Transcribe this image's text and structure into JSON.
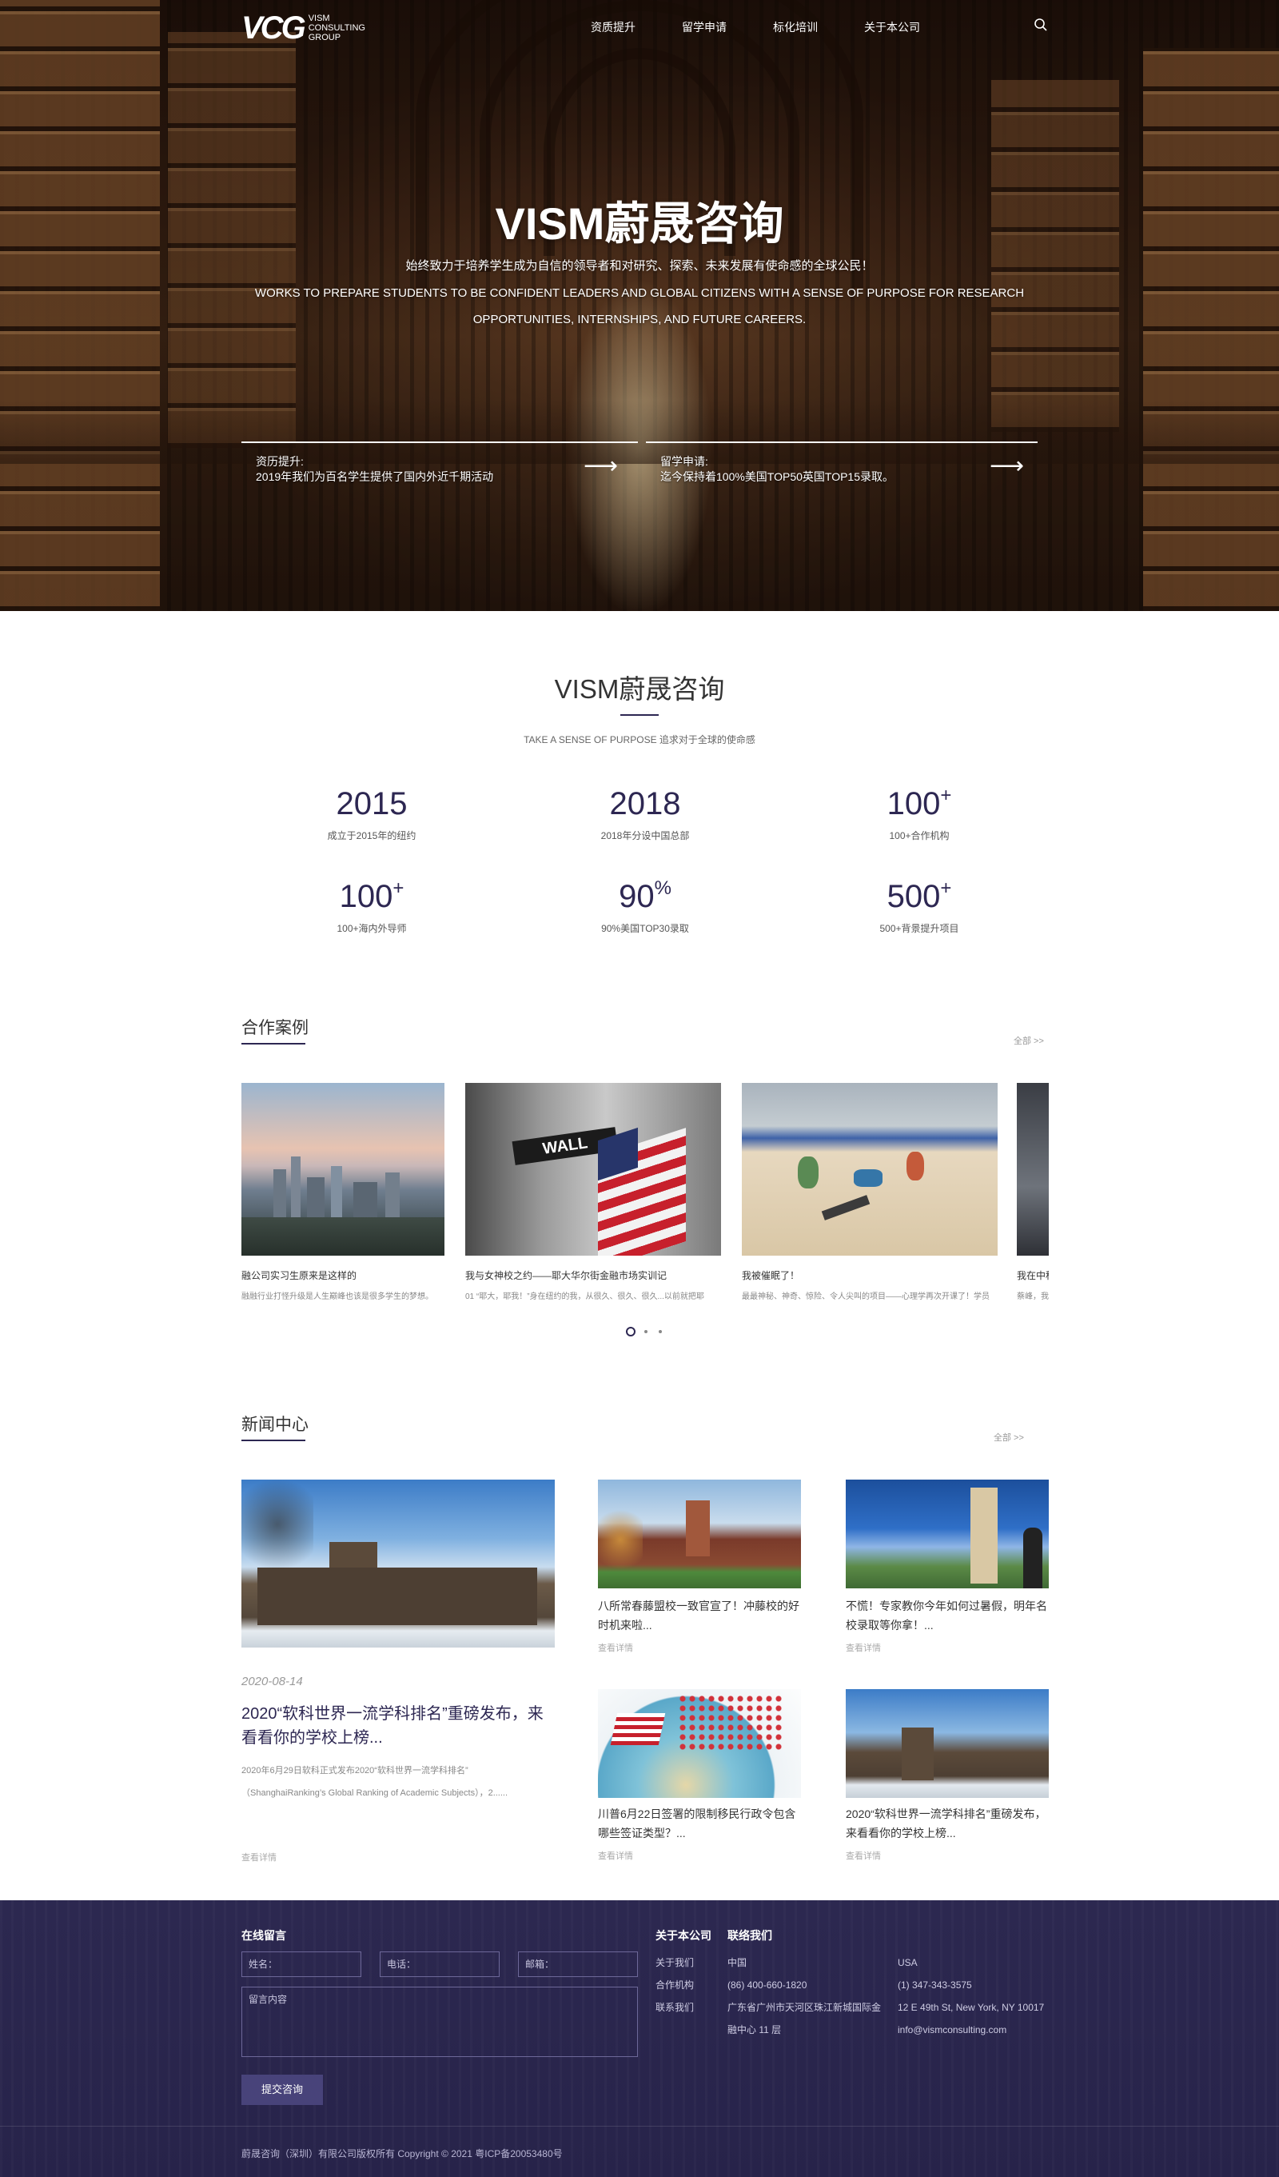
{
  "header": {
    "logo_mark": "VCG",
    "logo_text": "VISM CONSULTING GROUP",
    "nav": [
      "资质提升",
      "留学申请",
      "标化培训",
      "关于本公司"
    ]
  },
  "hero": {
    "title": "VISM蔚晟咨询",
    "subtitle_cn": "始终致力于培养学生成为自信的领导者和对研究、探索、未来发展有使命感的全球公民！",
    "subtitle_en_1": "WORKS TO PREPARE STUDENTS TO BE CONFIDENT LEADERS AND GLOBAL CITIZENS WITH A SENSE OF PURPOSE FOR RESEARCH",
    "subtitle_en_2": "OPPORTUNITIES, INTERNSHIPS, AND FUTURE CAREERS.",
    "links": [
      {
        "title": "资历提升:",
        "desc": "2019年我们为百名学生提供了国内外近千期活动"
      },
      {
        "title": "留学申请:",
        "desc": "迄今保持着100%美国TOP50英国TOP15录取。"
      }
    ]
  },
  "intro": {
    "title": "VISM蔚晟咨询",
    "subtitle": "TAKE A SENSE OF PURPOSE 追求对于全球的使命感",
    "stats": [
      {
        "num": "2015",
        "sup": "",
        "label": "成立于2015年的纽约"
      },
      {
        "num": "2018",
        "sup": "",
        "label": "2018年分设中国总部"
      },
      {
        "num": "100",
        "sup": "+",
        "label": "100+合作机构"
      },
      {
        "num": "100",
        "sup": "+",
        "label": "100+海内外导师"
      },
      {
        "num": "90",
        "sup": "%",
        "label": "90%美国TOP30录取"
      },
      {
        "num": "500",
        "sup": "+",
        "label": "500+背景提升项目"
      }
    ]
  },
  "cases": {
    "title": "合作案例",
    "more": "全部 >>",
    "items": [
      {
        "title": "融公司实习生原来是这样的",
        "desc": "融融行业打怪升级是人生巅峰也该是很多学生的梦想。"
      },
      {
        "title": "我与女神校之约——耶大华尔街金融市场实训记",
        "desc": "01 “耶大，耶我！”身在纽约的我，从很久、很久、很久...以前就把耶"
      },
      {
        "title": "我被催眠了！",
        "desc": "最最神秘、神奇、惊险、令人尖叫的项目——心理学再次开课了！学员"
      },
      {
        "title": "我在中科",
        "desc": "蔡峰，我"
      }
    ]
  },
  "news": {
    "title": "新闻中心",
    "more": "全部 >>",
    "featured": {
      "date": "2020-08-14",
      "title": "2020“软科世界一流学科排名”重磅发布，来看看你的学校上榜...",
      "desc_1": "2020年6月29日软科正式发布2020“软科世界一流学科排名”",
      "desc_2": "（ShanghaiRanking’s Global Ranking of Academic Subjects），2......",
      "more": "查看详情"
    },
    "items": [
      {
        "title": "八所常春藤盟校一致官宣了！冲藤校的好时机来啦...",
        "more": "查看详情"
      },
      {
        "title": "不慌！专家教你今年如何过暑假，明年名校录取等你拿！...",
        "more": "查看详情"
      },
      {
        "title": "川普6月22日签署的限制移民行政令包含哪些签证类型？...",
        "more": "查看详情"
      },
      {
        "title": "2020“软科世界一流学科排名”重磅发布，来看看你的学校上榜...",
        "more": "查看详情"
      }
    ]
  },
  "footer": {
    "message_title": "在线留言",
    "name_label": "姓名：",
    "phone_label": "电话：",
    "email_label": "邮箱：",
    "content_label": "留言内容",
    "submit": "提交咨询",
    "about_title": "关于本公司",
    "about_links": [
      "关于我们",
      "合作机构",
      "联系我们"
    ],
    "contact_title": "联络我们",
    "china": {
      "name": "中国",
      "phone": "(86) 400-660-1820",
      "addr_1": "广东省广州市天河区珠江新城国际金",
      "addr_2": "融中心 11 层"
    },
    "usa": {
      "name": "USA",
      "phone": "(1) 347-343-3575",
      "addr": "12 E 49th St, New York, NY 10017",
      "email": "info@vismconsulting.com"
    },
    "copyright": "蔚晟咨询（深圳）有限公司版权所有 Copyright © 2021 粤ICP备20053480号"
  }
}
